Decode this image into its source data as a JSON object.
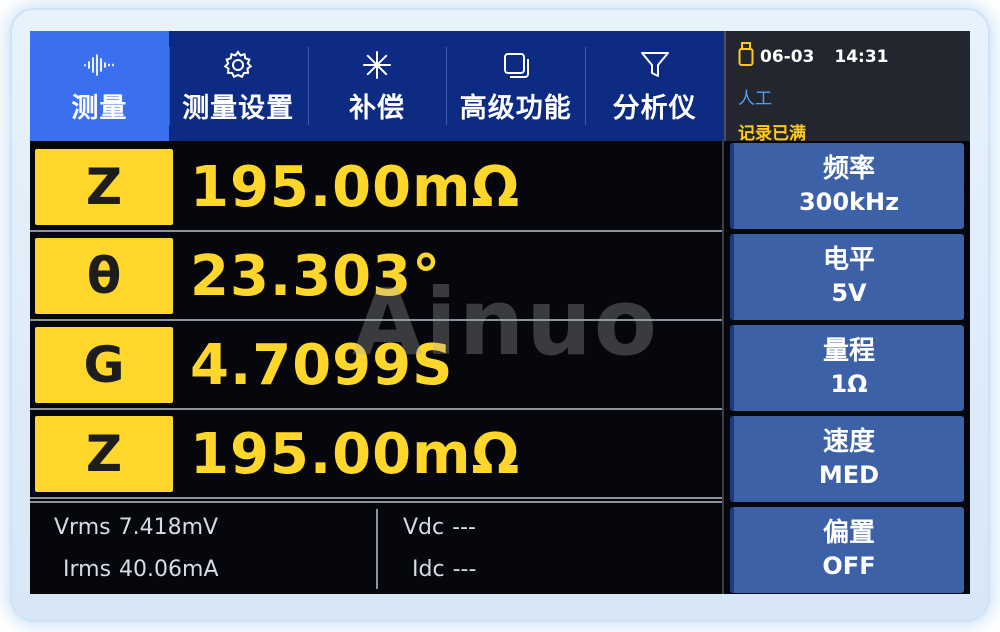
{
  "nav": {
    "tabs": [
      {
        "label": "测量",
        "icon": "waveform-icon"
      },
      {
        "label": "测量设置",
        "icon": "gear-icon"
      },
      {
        "label": "补偿",
        "icon": "asterisk-icon"
      },
      {
        "label": "高级功能",
        "icon": "layers-icon"
      },
      {
        "label": "分析仪",
        "icon": "filter-icon"
      }
    ],
    "active_tab": "测量"
  },
  "status": {
    "date": "06-03",
    "time": "14:31",
    "mode": "人工",
    "record": "记录已满",
    "icon": "usb-drive-icon",
    "mode_color": "#4ea0ff",
    "record_color": "#ffc81f"
  },
  "measurements": [
    {
      "param": "Z",
      "value": "195.00mΩ"
    },
    {
      "param": "θ",
      "value": "23.303°"
    },
    {
      "param": "G",
      "value": "4.7099S"
    },
    {
      "param": "Z",
      "value": "195.00mΩ"
    }
  ],
  "monitor": {
    "vrms_label": "Vrms",
    "vrms_value": "7.418mV",
    "irms_label": "Irms",
    "irms_value": "40.06mA",
    "vdc_label": "Vdc",
    "vdc_value": "---",
    "idc_label": "Idc",
    "idc_value": "---"
  },
  "softkeys": [
    {
      "title": "频率",
      "value": "300kHz"
    },
    {
      "title": "电平",
      "value": "5V"
    },
    {
      "title": "量程",
      "value": "1Ω"
    },
    {
      "title": "速度",
      "value": "MED"
    },
    {
      "title": "偏置",
      "value": "OFF"
    }
  ],
  "watermark": "Ainuo",
  "colors": {
    "accent_yellow": "#ffd62a",
    "nav_blue": "#0e2b84",
    "active_tab_blue": "#3a6ff0",
    "softkey_blue": "#3c61a7"
  }
}
